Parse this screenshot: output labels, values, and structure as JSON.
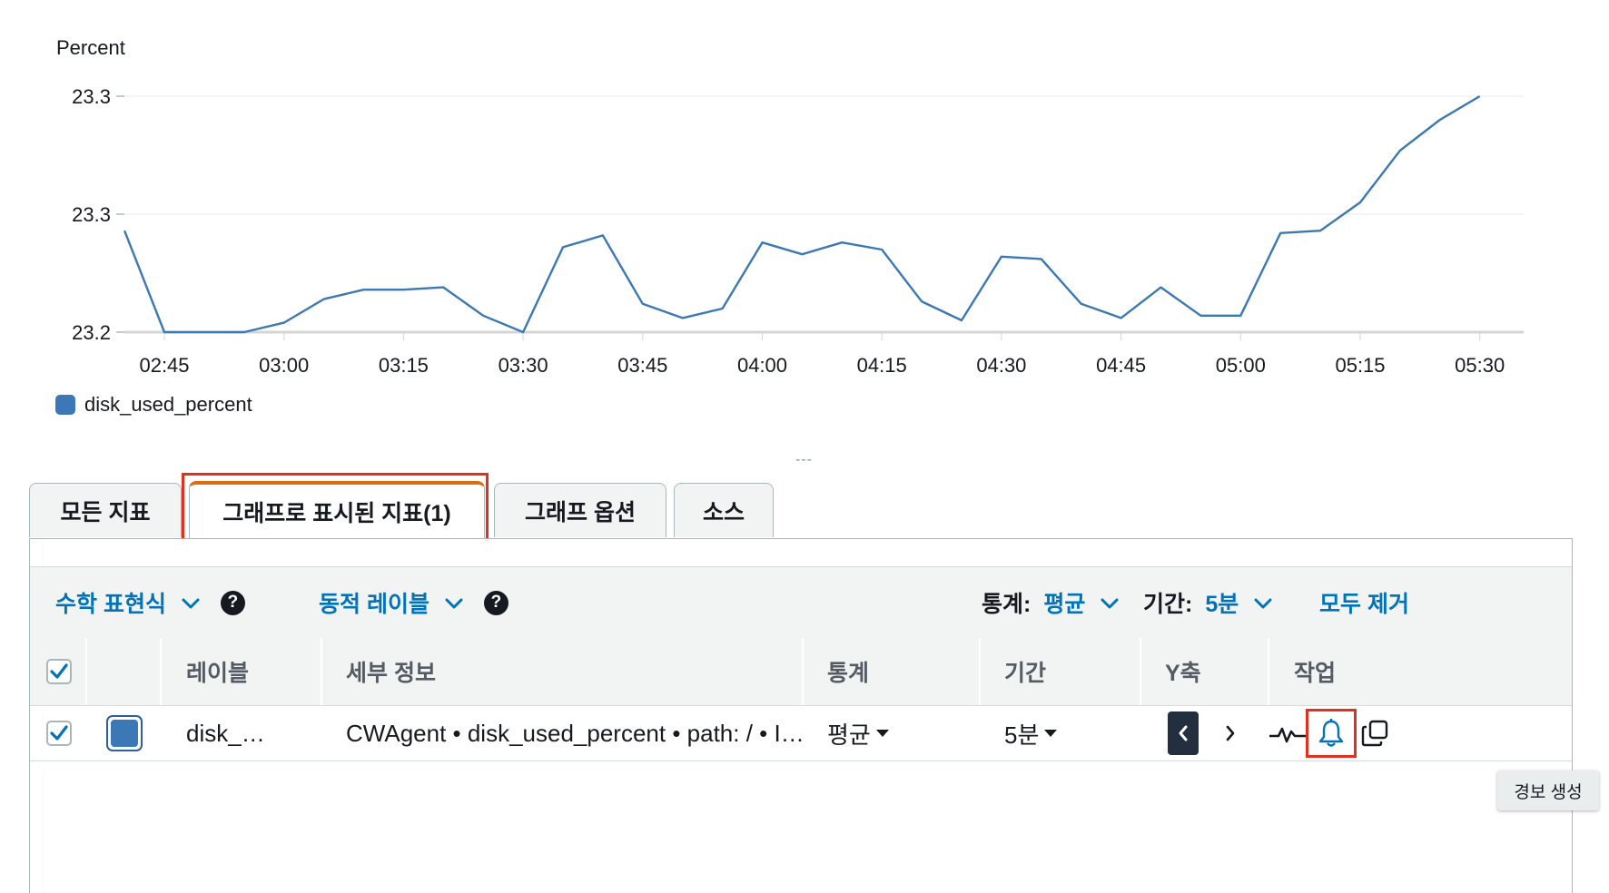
{
  "chart": {
    "y_unit": "Percent",
    "legend": {
      "label": "disk_used_percent",
      "color": "#3b78b5"
    }
  },
  "chart_data": {
    "type": "line",
    "title": "",
    "ylabel": "Percent",
    "xlabel": "",
    "y_tick_labels": [
      "23.3",
      "23.3",
      "23.2"
    ],
    "y_tick_values": [
      23.3,
      23.25,
      23.2
    ],
    "ylim": [
      23.2,
      23.3
    ],
    "x_tick_labels": [
      "02:45",
      "03:00",
      "03:15",
      "03:30",
      "03:45",
      "04:00",
      "04:15",
      "04:30",
      "04:45",
      "05:00",
      "05:15",
      "05:30"
    ],
    "x_range": [
      "02:45",
      "05:30"
    ],
    "grid": true,
    "legend_position": "bottom-left",
    "series": [
      {
        "name": "disk_used_percent",
        "color": "#3b78b5",
        "x": [
          "02:40",
          "02:45",
          "02:50",
          "02:55",
          "03:00",
          "03:05",
          "03:10",
          "03:15",
          "03:20",
          "03:25",
          "03:30",
          "03:35",
          "03:40",
          "03:45",
          "03:50",
          "03:55",
          "04:00",
          "04:05",
          "04:10",
          "04:15",
          "04:20",
          "04:25",
          "04:30",
          "04:35",
          "04:40",
          "04:45",
          "04:50",
          "04:55",
          "05:00",
          "05:05",
          "05:10",
          "05:15",
          "05:20",
          "05:25",
          "05:30"
        ],
        "values": [
          23.243,
          23.2,
          23.2,
          23.2,
          23.204,
          23.214,
          23.218,
          23.218,
          23.219,
          23.207,
          23.2,
          23.236,
          23.241,
          23.212,
          23.206,
          23.21,
          23.238,
          23.233,
          23.238,
          23.235,
          23.213,
          23.205,
          23.232,
          23.231,
          23.212,
          23.206,
          23.219,
          23.207,
          23.207,
          23.242,
          23.243,
          23.255,
          23.277,
          23.29,
          23.3
        ]
      }
    ]
  },
  "resize_handle": "---",
  "tabs": [
    {
      "label": "모든 지표"
    },
    {
      "label": "그래프로 표시된 지표(1)"
    },
    {
      "label": "그래프 옵션"
    },
    {
      "label": "소스"
    }
  ],
  "toolbar": {
    "math_expression": "수학 표현식",
    "dynamic_label": "동적 레이블",
    "help": "?",
    "stat_label": "통계:",
    "stat_value": "평균",
    "period_label": "기간:",
    "period_value": "5분",
    "remove_all": "모두 제거"
  },
  "table": {
    "headers": {
      "label": "레이블",
      "details": "세부 정보",
      "statistic": "통계",
      "period": "기간",
      "y_axis": "Y축",
      "actions": "작업"
    },
    "rows": [
      {
        "checked": true,
        "color": "#3b78b5",
        "label": "disk_…",
        "details": "CWAgent • disk_used_percent • path: / • I…",
        "statistic": "평균",
        "period": "5분"
      }
    ]
  },
  "tooltip": {
    "text": "경보 생성"
  },
  "colors": {
    "accent_link": "#0073bb",
    "active_tab_border": "#dd6b10",
    "highlight": "#e0301e",
    "checkbox": "#0073bb"
  },
  "icons": [
    "chevron-down-icon",
    "help-icon",
    "checkmark-icon",
    "caret-down-icon",
    "chevron-left-icon",
    "chevron-right-icon",
    "sparkline-icon",
    "bell-icon",
    "copy-icon"
  ]
}
